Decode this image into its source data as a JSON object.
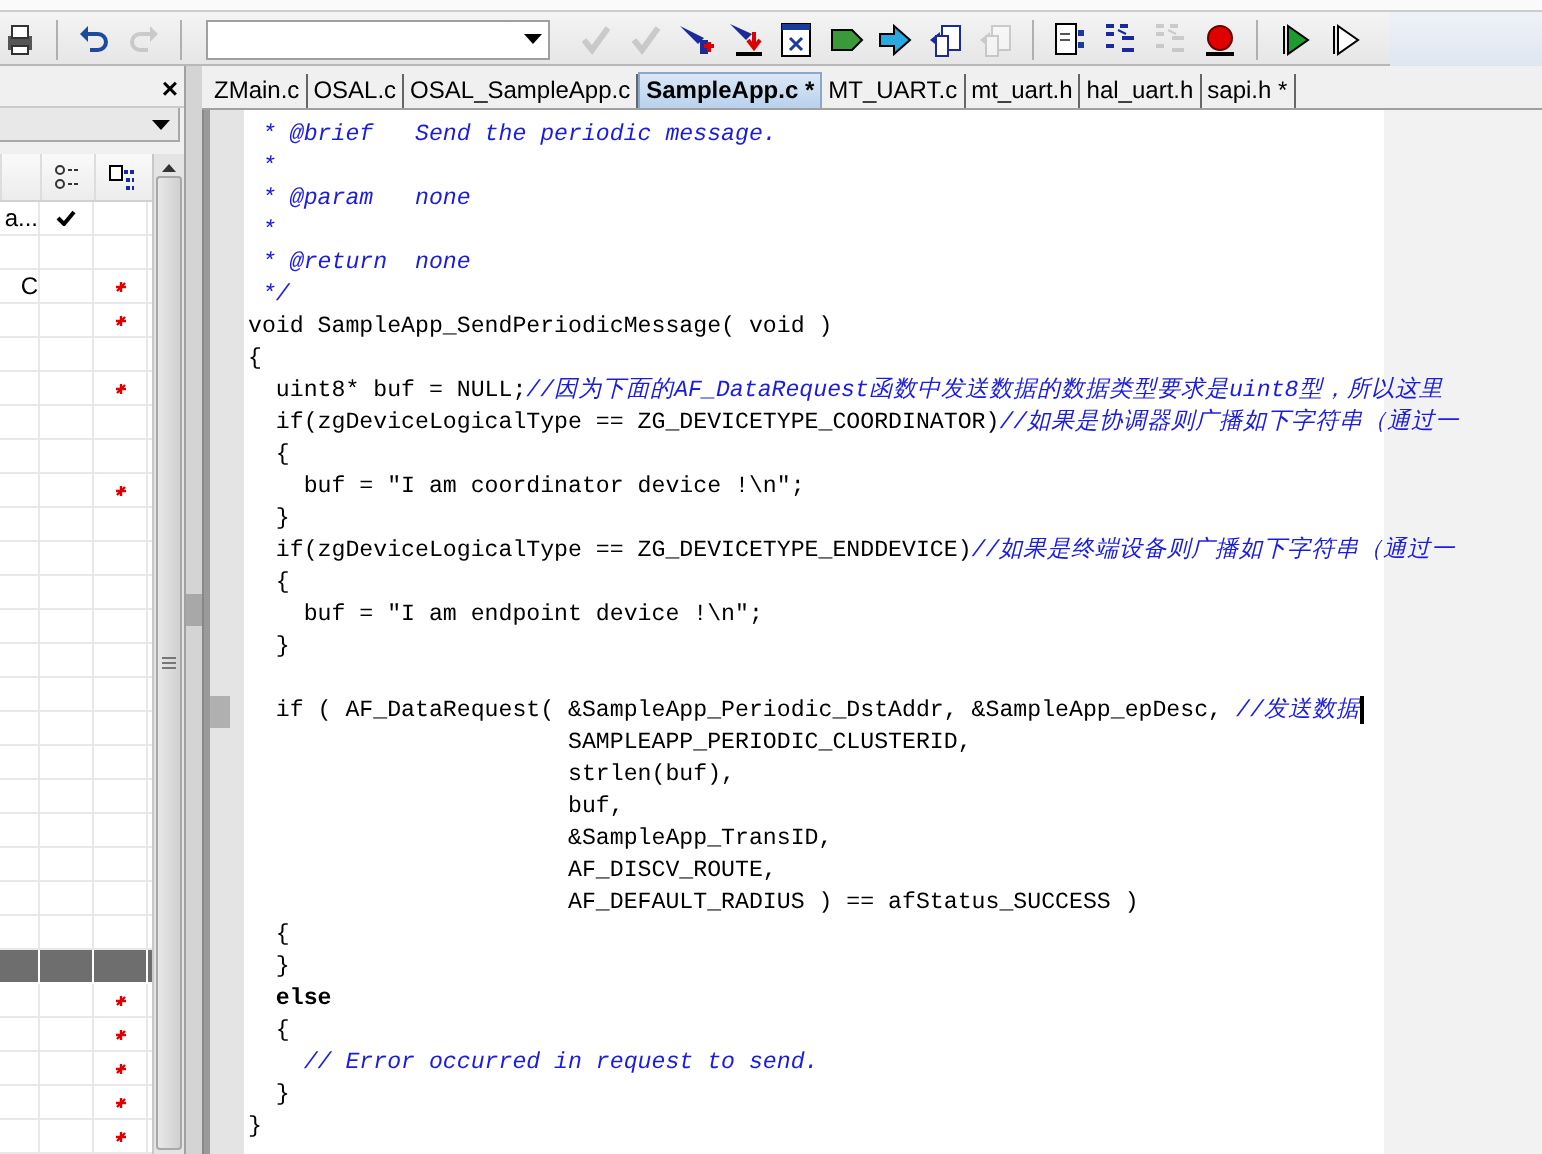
{
  "toolbar": {
    "buttons": [
      {
        "kind": "print",
        "disabled": false
      },
      {
        "kind": "undo",
        "disabled": false
      },
      {
        "kind": "redo",
        "disabled": true
      },
      {
        "kind": "combo",
        "disabled": false
      },
      {
        "kind": "tick",
        "disabled": true
      },
      {
        "kind": "tick",
        "disabled": true
      },
      {
        "kind": "funnel-plus",
        "disabled": false
      },
      {
        "kind": "funnel-down",
        "disabled": false
      },
      {
        "kind": "window",
        "disabled": false
      },
      {
        "kind": "tag",
        "disabled": false
      },
      {
        "kind": "arrow",
        "disabled": false
      },
      {
        "kind": "pages",
        "disabled": false
      },
      {
        "kind": "pages",
        "disabled": true
      },
      {
        "kind": "document",
        "disabled": false
      },
      {
        "kind": "grid",
        "disabled": false
      },
      {
        "kind": "grid",
        "disabled": true
      },
      {
        "kind": "breakpoint",
        "disabled": false
      },
      {
        "kind": "play",
        "disabled": false
      },
      {
        "kind": "play-outline",
        "disabled": false
      }
    ]
  },
  "workspace": {
    "close": "×",
    "rows": [
      {
        "name": "a...",
        "checked": true,
        "modified": false,
        "selected": false
      },
      {
        "checked": false,
        "modified": false,
        "selected": false
      },
      {
        "name": "C",
        "checked": false,
        "modified": true,
        "selected": false
      },
      {
        "checked": false,
        "modified": true,
        "selected": false
      },
      {
        "checked": false,
        "modified": false,
        "selected": false
      },
      {
        "checked": false,
        "modified": true,
        "selected": false
      },
      {
        "checked": false,
        "modified": false,
        "selected": false
      },
      {
        "checked": false,
        "modified": false,
        "selected": false
      },
      {
        "checked": false,
        "modified": true,
        "selected": false
      },
      {
        "checked": false,
        "modified": false,
        "selected": false
      },
      {
        "checked": false,
        "modified": false,
        "selected": false
      },
      {
        "checked": false,
        "modified": false,
        "selected": false
      },
      {
        "checked": false,
        "modified": false,
        "selected": false
      },
      {
        "checked": false,
        "modified": false,
        "selected": false
      },
      {
        "checked": false,
        "modified": false,
        "selected": false
      },
      {
        "checked": false,
        "modified": false,
        "selected": false
      },
      {
        "checked": false,
        "modified": false,
        "selected": false
      },
      {
        "checked": false,
        "modified": false,
        "selected": false
      },
      {
        "checked": false,
        "modified": false,
        "selected": false
      },
      {
        "checked": false,
        "modified": false,
        "selected": false
      },
      {
        "checked": false,
        "modified": false,
        "selected": false
      },
      {
        "checked": false,
        "modified": false,
        "selected": false
      },
      {
        "checked": false,
        "modified": false,
        "selected": true
      },
      {
        "checked": false,
        "modified": true,
        "selected": false
      },
      {
        "checked": false,
        "modified": true,
        "selected": false
      },
      {
        "checked": false,
        "modified": true,
        "selected": false
      },
      {
        "checked": false,
        "modified": true,
        "selected": false
      },
      {
        "checked": false,
        "modified": true,
        "selected": false
      }
    ]
  },
  "tabs": [
    {
      "label": "ZMain.c",
      "selected": false
    },
    {
      "label": "OSAL.c",
      "selected": false
    },
    {
      "label": "OSAL_SampleApp.c",
      "selected": false
    },
    {
      "label": "SampleApp.c *",
      "selected": true
    },
    {
      "label": "MT_UART.c",
      "selected": false
    },
    {
      "label": "mt_uart.h",
      "selected": false
    },
    {
      "label": "hal_uart.h",
      "selected": false
    },
    {
      "label": "sapi.h *",
      "selected": false
    }
  ],
  "editor": {
    "lines": [
      {
        "current": false,
        "segments": [
          {
            "kind": "comment",
            "text": " * @brief   Send the periodic message."
          }
        ]
      },
      {
        "current": false,
        "segments": [
          {
            "kind": "comment",
            "text": " *"
          }
        ]
      },
      {
        "current": false,
        "segments": [
          {
            "kind": "comment",
            "text": " * @param   none"
          }
        ]
      },
      {
        "current": false,
        "segments": [
          {
            "kind": "comment",
            "text": " *"
          }
        ]
      },
      {
        "current": false,
        "segments": [
          {
            "kind": "comment",
            "text": " * @return  none"
          }
        ]
      },
      {
        "current": false,
        "segments": [
          {
            "kind": "comment",
            "text": " */"
          }
        ]
      },
      {
        "current": false,
        "segments": [
          {
            "kind": "plain",
            "text": "void SampleApp_SendPeriodicMessage( void )"
          }
        ]
      },
      {
        "current": false,
        "segments": [
          {
            "kind": "plain",
            "text": "{"
          }
        ]
      },
      {
        "current": false,
        "segments": [
          {
            "kind": "plain",
            "text": "  uint8* buf = NULL;"
          },
          {
            "kind": "comment",
            "text": "//因为下面的AF_DataRequest函数中发送数据的数据类型要求是uint8型，所以这里"
          }
        ]
      },
      {
        "current": false,
        "segments": [
          {
            "kind": "plain",
            "text": "  if(zgDeviceLogicalType == ZG_DEVICETYPE_COORDINATOR)"
          },
          {
            "kind": "comment",
            "text": "//如果是协调器则广播如下字符串（通过一"
          }
        ]
      },
      {
        "current": false,
        "segments": [
          {
            "kind": "plain",
            "text": "  {"
          }
        ]
      },
      {
        "current": false,
        "segments": [
          {
            "kind": "plain",
            "text": "    buf = \"I am coordinator device !\\n\";"
          }
        ]
      },
      {
        "current": false,
        "segments": [
          {
            "kind": "plain",
            "text": "  }"
          }
        ]
      },
      {
        "current": false,
        "segments": [
          {
            "kind": "plain",
            "text": "  if(zgDeviceLogicalType == ZG_DEVICETYPE_ENDDEVICE)"
          },
          {
            "kind": "comment",
            "text": "//如果是终端设备则广播如下字符串（通过一"
          }
        ]
      },
      {
        "current": false,
        "segments": [
          {
            "kind": "plain",
            "text": "  {"
          }
        ]
      },
      {
        "current": false,
        "segments": [
          {
            "kind": "plain",
            "text": "    buf = \"I am endpoint device !\\n\";"
          }
        ]
      },
      {
        "current": false,
        "segments": [
          {
            "kind": "plain",
            "text": "  }"
          }
        ]
      },
      {
        "current": false
      },
      {
        "current": true,
        "segments": [
          {
            "kind": "plain",
            "text": "  if ( AF_DataRequest( &SampleApp_Periodic_DstAddr, &SampleApp_epDesc, "
          },
          {
            "kind": "comment",
            "text": "//发送数据"
          }
        ]
      },
      {
        "current": false,
        "segments": [
          {
            "kind": "plain",
            "text": "                       SAMPLEAPP_PERIODIC_CLUSTERID,"
          }
        ]
      },
      {
        "current": false,
        "segments": [
          {
            "kind": "plain",
            "text": "                       strlen(buf),"
          }
        ]
      },
      {
        "current": false,
        "segments": [
          {
            "kind": "plain",
            "text": "                       buf,"
          }
        ]
      },
      {
        "current": false,
        "segments": [
          {
            "kind": "plain",
            "text": "                       &SampleApp_TransID,"
          }
        ]
      },
      {
        "current": false,
        "segments": [
          {
            "kind": "plain",
            "text": "                       AF_DISCV_ROUTE,"
          }
        ]
      },
      {
        "current": false,
        "segments": [
          {
            "kind": "plain",
            "text": "                       AF_DEFAULT_RADIUS ) == afStatus_SUCCESS )"
          }
        ]
      },
      {
        "current": false,
        "segments": [
          {
            "kind": "plain",
            "text": "  {"
          }
        ]
      },
      {
        "current": false,
        "segments": [
          {
            "kind": "plain",
            "text": "  }"
          }
        ]
      },
      {
        "current": false,
        "segments": [
          {
            "kind": "keyword",
            "text": "  else"
          }
        ]
      },
      {
        "current": false,
        "segments": [
          {
            "kind": "plain",
            "text": "  {"
          }
        ]
      },
      {
        "current": false,
        "segments": [
          {
            "kind": "comment",
            "text": "    // Error occurred in request to send."
          }
        ]
      },
      {
        "current": false,
        "segments": [
          {
            "kind": "plain",
            "text": "  }"
          }
        ]
      },
      {
        "current": false,
        "segments": [
          {
            "kind": "plain",
            "text": "}"
          }
        ]
      }
    ]
  }
}
